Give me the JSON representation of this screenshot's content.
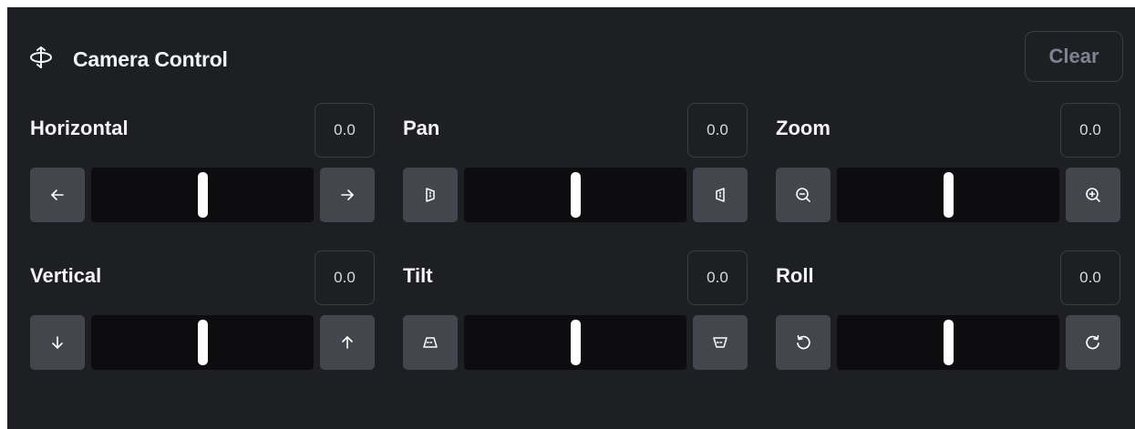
{
  "header": {
    "title": "Camera Control",
    "clear_label": "Clear",
    "icon": "camera-control-icon"
  },
  "colors": {
    "panel_bg": "#1e1f23",
    "button_bg": "#44464e",
    "track_bg": "#0d0d0f",
    "thumb": "#ffffff",
    "disabled_text": "#7f8290"
  },
  "controls": [
    {
      "key": "horizontal",
      "label": "Horizontal",
      "value": "0.0",
      "level": 0.5,
      "left_icon": "arrow-left-icon",
      "right_icon": "arrow-right-icon"
    },
    {
      "key": "pan",
      "label": "Pan",
      "value": "0.0",
      "level": 0.5,
      "left_icon": "pan-left-icon",
      "right_icon": "pan-right-icon"
    },
    {
      "key": "zoom",
      "label": "Zoom",
      "value": "0.0",
      "level": 0.5,
      "left_icon": "zoom-out-icon",
      "right_icon": "zoom-in-icon"
    },
    {
      "key": "vertical",
      "label": "Vertical",
      "value": "0.0",
      "level": 0.5,
      "left_icon": "arrow-down-icon",
      "right_icon": "arrow-up-icon"
    },
    {
      "key": "tilt",
      "label": "Tilt",
      "value": "0.0",
      "level": 0.5,
      "left_icon": "tilt-down-icon",
      "right_icon": "tilt-up-icon"
    },
    {
      "key": "roll",
      "label": "Roll",
      "value": "0.0",
      "level": 0.5,
      "left_icon": "rotate-ccw-icon",
      "right_icon": "rotate-cw-icon"
    }
  ]
}
